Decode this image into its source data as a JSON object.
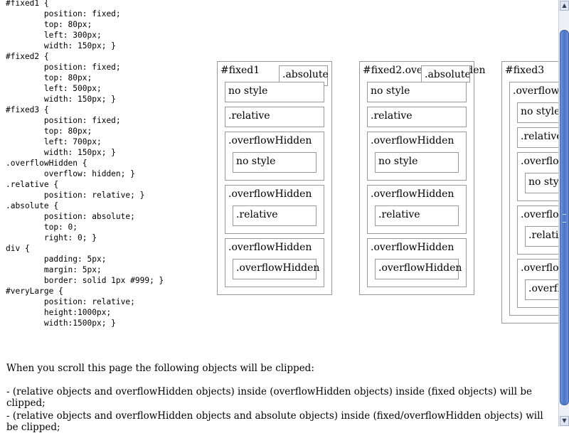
{
  "code_lines": [
    "#fixed1 {",
    "        position: fixed;",
    "        top: 80px;",
    "        left: 300px;",
    "        width: 150px; }",
    "#fixed2 {",
    "        position: fixed;",
    "        top: 80px;",
    "        left: 500px;",
    "        width: 150px; }",
    "#fixed3 {",
    "        position: fixed;",
    "        top: 80px;",
    "        left: 700px;",
    "        width: 150px; }",
    ".overflowHidden {",
    "        overflow: hidden; }",
    ".relative {",
    "        position: relative; }",
    ".absolute {",
    "        position: absolute;",
    "        top: 0;",
    "        right: 0; }",
    "div {",
    "        padding: 5px;",
    "        margin: 5px;",
    "        border: solid 1px #999; }",
    "#veryLarge {",
    "        position: relative;",
    "        height:1000px;",
    "        width:1500px; }"
  ],
  "demo": {
    "fixed1": {
      "title": "#fixed1",
      "absolute": ".absolute",
      "no_style": "no style",
      "relative": ".relative",
      "ovh1": ".overflowHidden",
      "ovh1_child": "no style",
      "ovh2": ".overflowHidden",
      "ovh2_child": ".relative",
      "ovh3": ".overflowHidden",
      "ovh3_child": ".overflowHidden"
    },
    "fixed2": {
      "title": "#fixed2.overflowHidden",
      "absolute": ".absolute",
      "no_style": "no style",
      "relative": ".relative",
      "ovh1": ".overflowHidden",
      "ovh1_child": "no style",
      "ovh2": ".overflowHidden",
      "ovh2_child": ".relative",
      "ovh3": ".overflowHidden",
      "ovh3_child": ".overflowHidden"
    },
    "fixed3": {
      "title": "#fixed3",
      "inner_title": ".overflowHidden",
      "no_style": "no style",
      "relative": ".relative",
      "ovh1": ".overflowHidden",
      "ovh1_child": "no style",
      "ovh2": ".overflowHidden",
      "ovh2_child": ".relative",
      "ovh3": ".overflowHidden",
      "ovh3_child": ".overflowHidden"
    }
  },
  "description": {
    "intro": "When you scroll this page the following objects will be clipped:",
    "item1": "- (relative objects and overflowHidden objects) inside (overflowHidden objects) inside (fixed objects) will be clipped;",
    "item2": "- (relative objects and overflowHidden objects and absolute objects) inside (fixed/overflowHidden objects) will be clipped;"
  },
  "scrollbar": {
    "up_icon": "arrow-up",
    "down_icon": "arrow-down",
    "thumb_color": "#4a73c6"
  }
}
